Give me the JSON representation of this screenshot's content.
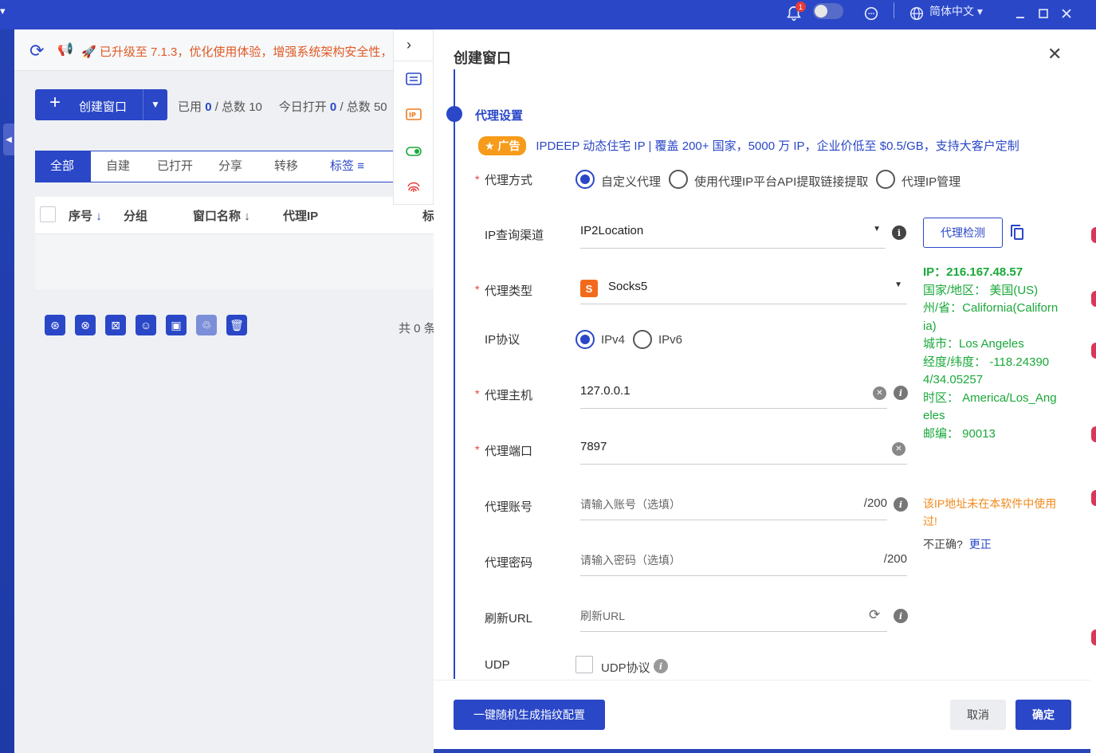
{
  "titlebar": {
    "left_caret": "▾",
    "notification_count": "1",
    "language": "简体中文 ▾",
    "window_controls": [
      "minimize-icon",
      "maximize-icon",
      "close-icon"
    ]
  },
  "notice": {
    "message": "🚀 已升级至 7.1.3，优化使用体验，增强系统架构安全性，"
  },
  "toolbar": {
    "create_label": "创建窗口",
    "used_label": "已用",
    "used_value": "0",
    "total_label": "/ 总数 10",
    "today_label": "今日打开",
    "today_value": "0",
    "today_total_label": "/ 总数 50"
  },
  "tabs": [
    {
      "label": "全部"
    },
    {
      "label": "自建"
    },
    {
      "label": "已打开"
    },
    {
      "label": "分享"
    },
    {
      "label": "转移"
    },
    {
      "label": "标签"
    }
  ],
  "table": {
    "columns": [
      "序号",
      "分组",
      "窗口名称",
      "代理IP",
      "标"
    ]
  },
  "footer_total": "共 0 条",
  "dialog": {
    "title": "创建窗口",
    "section_title": "代理设置",
    "ad_badge": "广告",
    "ad_text": "IPDEEP 动态住宅 IP | 覆盖 200+ 国家，5000 万 IP，企业价低至 $0.5/GB，支持大客户定制",
    "proxy_mode_label": "代理方式",
    "proxy_mode_options": [
      "自定义代理",
      "使用代理IP平台API提取链接提取",
      "代理IP管理"
    ],
    "ip_query_label": "IP查询渠道",
    "ip_query_value": "IP2Location",
    "proxy_type_label": "代理类型",
    "proxy_type_value": "Socks5",
    "ip_protocol_label": "IP协议",
    "ip_protocol_options": [
      "IPv4",
      "IPv6"
    ],
    "host_label": "代理主机",
    "host_value": "127.0.0.1",
    "port_label": "代理端口",
    "port_value": "7897",
    "account_label": "代理账号",
    "account_placeholder": "请输入账号（选填）",
    "account_count": "/200",
    "password_label": "代理密码",
    "password_placeholder": "请输入密码（选填）",
    "password_count": "/200",
    "refresh_label": "刷新URL",
    "refresh_placeholder": "刷新URL",
    "udp_label": "UDP",
    "udp_checkbox_label": "UDP协议",
    "detect_button": "代理检测",
    "ip_info": {
      "ip": "IP：216.167.48.57",
      "country": "国家/地区： 美国(US)",
      "state": "州/省：California(California)",
      "city": "城市：Los Angeles",
      "coords": "经度/纬度： -118.243904/34.05257",
      "timezone": "时区： America/Los_Angeles",
      "zip": "邮编： 90013"
    },
    "warning": "该IP地址未在本软件中使用过!",
    "incorrect_q": "不正确?",
    "correct_link": "更正",
    "random_button": "一键随机生成指纹配置",
    "cancel_button": "取消",
    "ok_button": "确定"
  }
}
